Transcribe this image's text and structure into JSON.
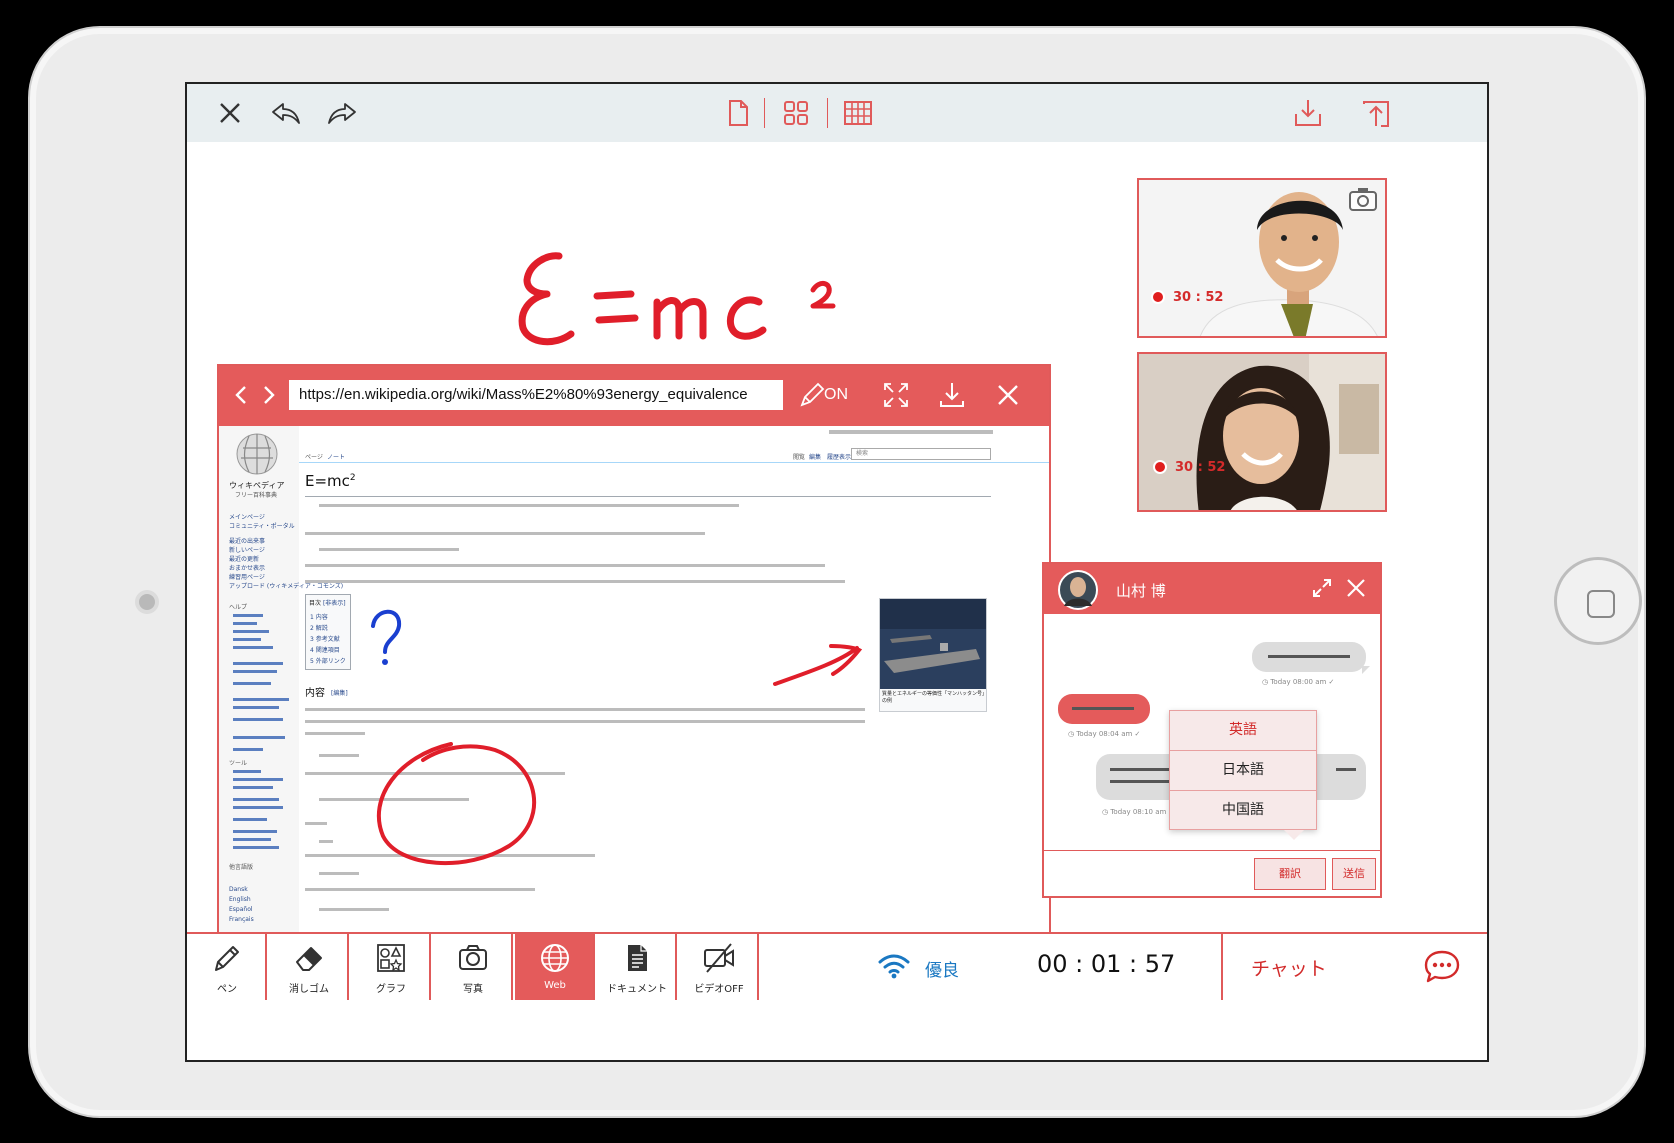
{
  "browser": {
    "url": "https://en.wikipedia.org/wiki/Mass%E2%80%93energy_equivalence",
    "pen_mode": "ON"
  },
  "wiki": {
    "logo_text": "ウィキペディア",
    "logo_sub": "フリー百科事典",
    "title": "E=mc",
    "title_sup": "2",
    "tab_page": "ページ",
    "tab_note": "ノート",
    "tab_read": "閲覧",
    "tab_edit": "編集",
    "tab_history": "履歴表示",
    "search_placeholder": "検索",
    "toc_title": "目次",
    "toc_hide": "[非表示]",
    "toc_items": [
      "1 内容",
      "2 解説",
      "3 参考文献",
      "4 関連項目",
      "5 外部リンク"
    ],
    "section_heading": "内容",
    "section_edit": "[編集]",
    "sidebar": [
      "メインページ",
      "コミュニティ・ポータル",
      "最近の出来事",
      "新しいページ",
      "最近の更新",
      "おまかせ表示",
      "練習用ページ",
      "アップロード (ウィキメディア・コモンズ)"
    ],
    "sidebar_help": "ヘルプ",
    "sidebar_tools": "ツール",
    "sidebar_lang": "他言語版",
    "lang_list": [
      "Dansk",
      "English",
      "Español",
      "Français"
    ],
    "image_caption": "質量とエネルギーの等価性「マンハッタン号」の例"
  },
  "videos": [
    {
      "rec_time": "30 : 52"
    },
    {
      "rec_time": "30 : 52"
    }
  ],
  "chat": {
    "name": "山村 博",
    "messages": [
      {
        "side": "right",
        "time": "Today 08:00 am"
      },
      {
        "side": "left",
        "time": "Today 08:04 am"
      },
      {
        "side": "right",
        "time": "Today 08:10 am"
      }
    ],
    "languages": [
      "英語",
      "日本語",
      "中国語"
    ],
    "translate_label": "翻訳",
    "send_label": "送信"
  },
  "toolbar": {
    "tools": [
      {
        "label": "ペン",
        "icon": "pen-icon"
      },
      {
        "label": "消しゴム",
        "icon": "eraser-icon"
      },
      {
        "label": "グラフ",
        "icon": "shapes-icon"
      },
      {
        "label": "写真",
        "icon": "camera-icon"
      },
      {
        "label": "Web",
        "icon": "globe-icon"
      },
      {
        "label": "ドキュメント",
        "icon": "document-icon"
      },
      {
        "label": "ビデオOFF",
        "icon": "video-off-icon"
      }
    ],
    "active_tool": "Web",
    "connection_label": "優良",
    "timer": "00 : 01 : 57",
    "chat_label": "チャット"
  },
  "colors": {
    "accent": "#e45b5b",
    "ink": "#e01e2a",
    "blue_ink": "#1a3fd0",
    "wifi": "#1a78c2"
  }
}
